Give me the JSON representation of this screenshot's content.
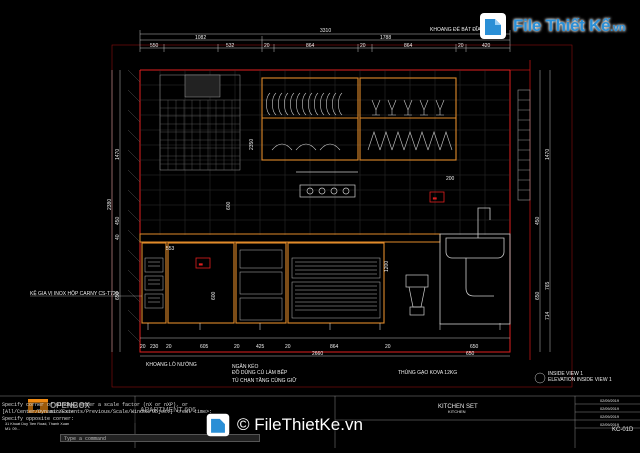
{
  "watermark": {
    "site_name": "File Thiết Kế",
    "site_domain": ".vn",
    "bottom_text": "© FileThietKe.vn"
  },
  "drawing": {
    "top_dimensions": [
      "3310",
      "1082",
      "1788",
      "550",
      "532",
      "20",
      "864",
      "20",
      "864",
      "20",
      "420"
    ],
    "note_top": "KHOANG ĐỂ BÁT ĐĨA, LY TÁCH",
    "left_dimensions": [
      "1470",
      "2380",
      "450",
      "650",
      "40",
      "45",
      "40",
      "20"
    ],
    "right_dimensions": [
      "1470",
      "450",
      "650",
      "765",
      "714",
      "15"
    ],
    "height_labels": [
      "2350",
      "45",
      "20",
      "40"
    ],
    "inner_labels": [
      "200",
      "553",
      "600",
      "1200",
      "600"
    ],
    "note_left": "KỆ GIA VỊ INOX HỘP CARNY CS-T720",
    "bottom_dimensions": [
      "20",
      "230",
      "20",
      "605",
      "20",
      "425",
      "20",
      "864",
      "20",
      "650"
    ],
    "bottom_total": "2660",
    "bottom_right_dim": "650",
    "note_bottom_1": "KHOANG LÒ NƯỚNG",
    "note_bottom_2": "NGĂN KÉO",
    "note_bottom_3": "ĐỒ DÙNG CỦ LÀM BẾP",
    "note_bottom_4": "TỦ CHẠN TẦNG CÙNG GIỮ",
    "note_bottom_5": "THÙNG GẠO KOVA 12KG",
    "inside_view": "INSIDE VIEW 1",
    "inside_view_sub": "ELEVATION INSIDE VIEW 1"
  },
  "title_block": {
    "company": "OPENBOX",
    "company_sub": "architecture",
    "address_1": "31 Khuat Duy Tien Road, Thanh Xuan",
    "address_2": "M1: 09...",
    "project": "APARTMENT 606",
    "sheet_title": "KITCHEN SET",
    "sheet_sub": "KITCHEN",
    "sheet_code": "KC-01D",
    "date_1": "02/09/2019",
    "date_2": "02/09/2019",
    "date_3": "02/09/2019",
    "date_4": "02/09/2019"
  },
  "command_line": {
    "line_1": "Specify corner of window, enter a scale factor (nX or nXP), or",
    "line_2": "[All/Center/Dynamic/Extents/Previous/Scale/Window/Object] <real time>:",
    "line_3": "Specify opposite corner:",
    "prompt": "Type a command"
  },
  "colors": {
    "background": "#000000",
    "cabinet": "#e08a2a",
    "frame": "#d01010",
    "dimension": "#f0f0f0",
    "watermark": "#2a8fd6"
  }
}
